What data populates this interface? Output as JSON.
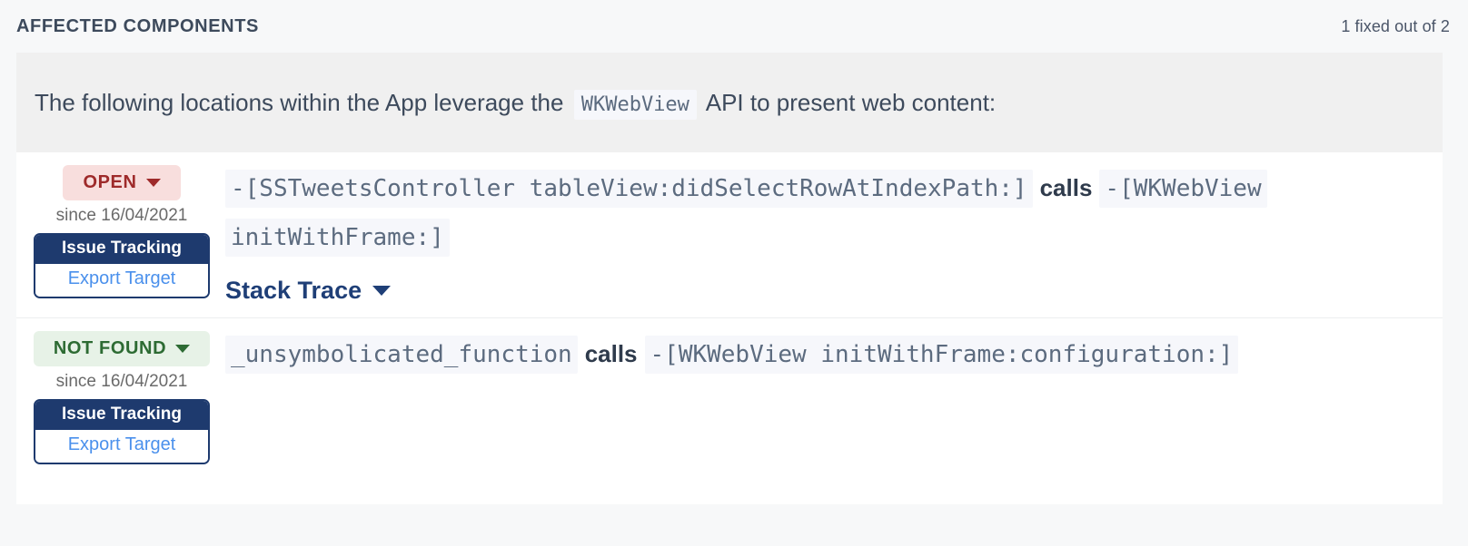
{
  "header": {
    "title": "AFFECTED COMPONENTS",
    "fixed_status": "1 fixed out of 2"
  },
  "banner": {
    "text_before": "The following locations within the App leverage the",
    "api_name": "WKWebView",
    "text_after": "API to present web content:"
  },
  "colors": {
    "open_badge_bg": "#f8dedd",
    "open_badge_text": "#9e2a2a",
    "notfound_badge_bg": "#e7f2e7",
    "notfound_badge_text": "#2d6b33",
    "tracking_navy": "#1e3a6e",
    "link_blue": "#4a90ec",
    "code_chip_bg": "#f6f7fb",
    "code_chip_text": "#5c6b7f",
    "banner_bg": "#f0f0f0",
    "page_bg": "#f7f8f9"
  },
  "rows": [
    {
      "status_label": "OPEN",
      "status_kind": "open",
      "since_label": "since 16/04/2021",
      "tracking_header": "Issue Tracking",
      "tracking_link": "Export Target",
      "caller": "-[SSTweetsController tableView:didSelectRowAtIndexPath:]",
      "relation": "calls",
      "callee": "-[WKWebView initWithFrame:]",
      "stack_trace_label": "Stack Trace",
      "has_stack_trace": true
    },
    {
      "status_label": "NOT FOUND",
      "status_kind": "notfound",
      "since_label": "since 16/04/2021",
      "tracking_header": "Issue Tracking",
      "tracking_link": "Export Target",
      "caller": "_unsymbolicated_function",
      "relation": "calls",
      "callee": "-[WKWebView initWithFrame:configuration:]",
      "stack_trace_label": "",
      "has_stack_trace": false
    }
  ]
}
